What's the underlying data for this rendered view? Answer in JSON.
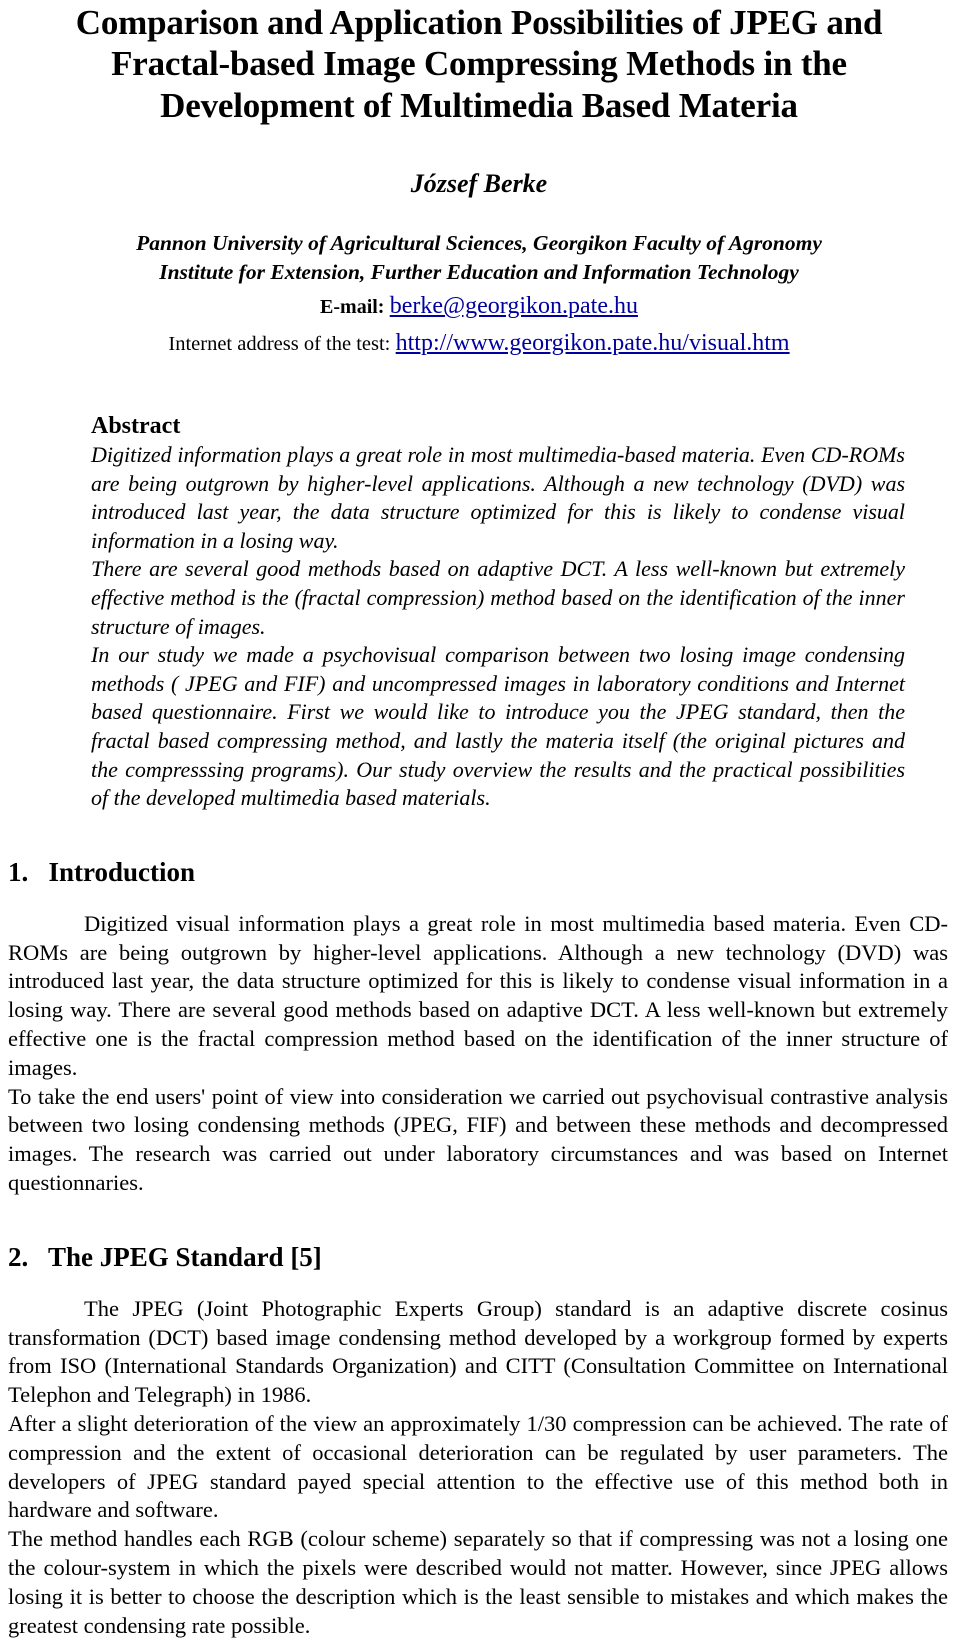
{
  "document": {
    "title_lines": [
      "Comparison and Application Possibilities of JPEG and",
      "Fractal-based Image Compressing Methods in the",
      "Development of Multimedia Based Materia"
    ],
    "author": "József Berke",
    "affiliation_lines": [
      "Pannon University of Agricultural Sciences, Georgikon Faculty of Agronomy",
      "Institute for Extension, Further Education and Information Technology"
    ],
    "email_label": "E-mail:",
    "email_address": "berke@georgikon.pate.hu",
    "test_address_label": "Internet address of the test:",
    "test_address_url": "http://www.georgikon.pate.hu/visual.htm",
    "link_color": "#0000A0"
  },
  "abstract": {
    "heading": "Abstract",
    "paragraphs": [
      "Digitized information plays a great role in most multimedia-based materia. Even CD-ROMs are being outgrown by higher-level applications. Although a new technology (DVD) was introduced last year, the data structure  optimized for this is likely to condense visual information in a losing way.",
      "There are several good methods based on adaptive DCT. A less well-known but extremely effective method is the (fractal compression) method based on the identification of the inner structure of images.",
      "In our study we made a psychovisual comparison between two losing image condensing methods ( JPEG and FIF) and uncompressed images in laboratory conditions and Internet based questionnaire. First we would like to introduce you the JPEG standard, then the fractal based compressing method, and lastly  the materia itself (the original pictures and the compresssing programs). Our study overview the results and the practical possibilities of the developed multimedia based materials."
    ]
  },
  "sections": [
    {
      "number": "1.",
      "title": "Introduction",
      "heading_full": "1.   Introduction",
      "paragraphs": [
        "Digitized visual information plays a great role in most multimedia based materia. Even CD-ROMs are being outgrown by higher-level applications. Although a new technology (DVD) was introduced last year, the data structure optimized for this is likely to condense visual information in a losing way. There are several good methods based on adaptive DCT. A less well-known but extremely effective one is the fractal compression method  based on the identification of the inner structure of images.",
        "To take the end users' point of view into consideration we carried out psychovisual contrastive analysis between two losing condensing methods (JPEG, FIF) and between these methods and decompressed images. The research was carried out under laboratory circumstances and was based on Internet questionnaries."
      ]
    },
    {
      "number": "2.",
      "title": "The JPEG Standard [5]",
      "heading_full": "2.   The JPEG Standard [5]",
      "paragraphs": [
        "The JPEG (Joint Photographic Experts Group) standard is an adaptive discrete cosinus transformation (DCT) based image condensing method developed by a workgroup formed by experts from ISO (International Standards Organization) and CITT (Consultation Committee on International Telephon and Telegraph) in 1986.",
        "After a slight deterioration of the view an approximately 1/30 compression can be achieved. The rate of compression and the extent of occasional deterioration can be regulated by user parameters. The developers of JPEG standard payed special attention to the effective use of this method both in hardware and software.",
        "The method handles each RGB (colour scheme) separately so that if compressing was not a losing one the colour-system in which the pixels were described would not matter. However, since JPEG allows losing it is better to choose the description which is the least sensible to mistakes and which makes the greatest condensing rate possible."
      ]
    }
  ]
}
